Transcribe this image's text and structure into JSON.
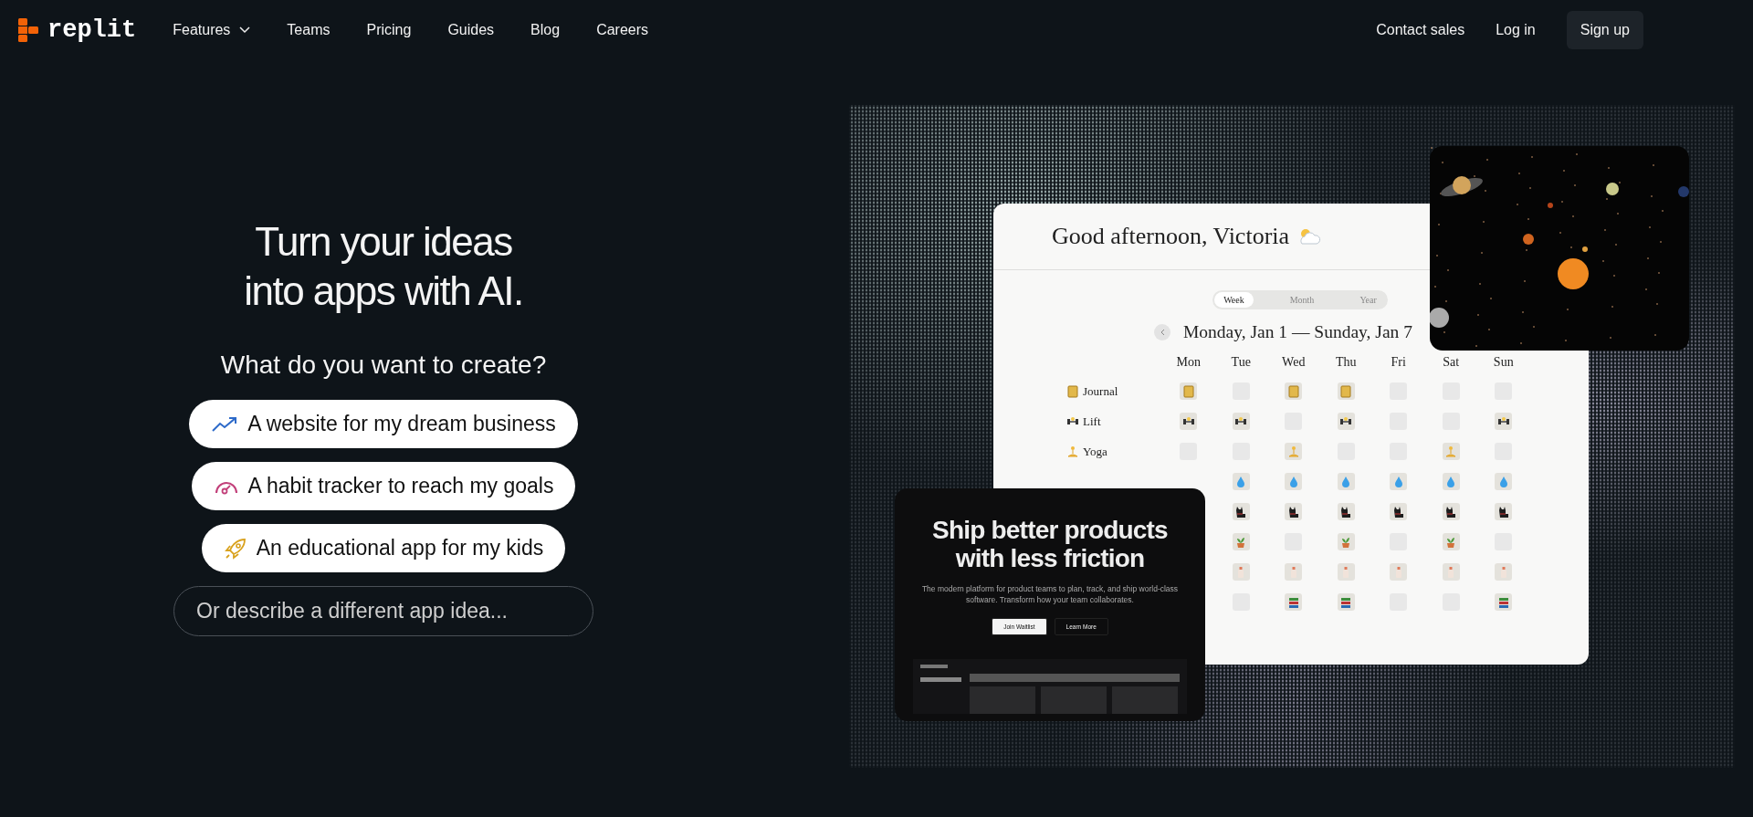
{
  "nav": {
    "logo": "replit",
    "links": [
      {
        "label": "Features",
        "kind": "dropdown"
      },
      {
        "label": "Teams",
        "kind": "link"
      },
      {
        "label": "Pricing",
        "kind": "link"
      },
      {
        "label": "Guides",
        "kind": "link"
      },
      {
        "label": "Blog",
        "kind": "link"
      },
      {
        "label": "Careers",
        "kind": "link"
      }
    ],
    "actions": [
      {
        "label": "Contact sales",
        "kind": "link"
      },
      {
        "label": "Log in",
        "kind": "link"
      },
      {
        "label": "Sign up",
        "kind": "button"
      }
    ]
  },
  "hero": {
    "title": "Turn your ideas into apps with AI.",
    "question": "What do you want to create?",
    "suggestions": [
      {
        "label": "A website for my dream business",
        "kind": "trend"
      },
      {
        "label": "A habit tracker to reach my goals",
        "kind": "gauge"
      },
      {
        "label": "An educational app for my kids",
        "kind": "rocket"
      }
    ],
    "idea_field": {
      "placeholder": "Or describe a different app idea..."
    }
  },
  "habit_app": {
    "greeting": "Good afternoon, Victoria",
    "views": [
      {
        "label": "Week",
        "selected": true
      },
      {
        "label": "Month",
        "selected": false
      },
      {
        "label": "Year",
        "selected": false
      }
    ],
    "range": "Monday, Jan 1 — Sunday, Jan 7",
    "days": [
      "Mon",
      "Tue",
      "Wed",
      "Thu",
      "Fri",
      "Sat",
      "Sun"
    ],
    "habits": [
      {
        "label": "Journal",
        "done": [
          true,
          false,
          true,
          true,
          false,
          false,
          false
        ]
      },
      {
        "label": "Lift",
        "done": [
          true,
          true,
          false,
          true,
          false,
          false,
          true
        ]
      },
      {
        "label": "Yoga",
        "done": [
          false,
          false,
          true,
          false,
          false,
          true,
          false
        ]
      },
      {
        "done": [
          true,
          true,
          true,
          true,
          true,
          true
        ]
      },
      {
        "done": [
          true,
          true,
          true,
          true,
          true,
          true
        ]
      },
      {
        "done": [
          true,
          false,
          true,
          false,
          true,
          false
        ]
      },
      {
        "done": [
          true,
          true,
          true,
          true,
          true,
          true
        ]
      },
      {
        "done": [
          false,
          true,
          true,
          false,
          false,
          true
        ]
      }
    ]
  },
  "product_app": {
    "title": "Ship better products with less friction",
    "text": "The modern platform for product teams to plan, track, and ship world-class software. Transform how your team collaborates.",
    "buttons": [
      {
        "label": "Join Waitlist",
        "kind": "primary"
      },
      {
        "label": "Learn More",
        "kind": "secondary"
      }
    ]
  }
}
